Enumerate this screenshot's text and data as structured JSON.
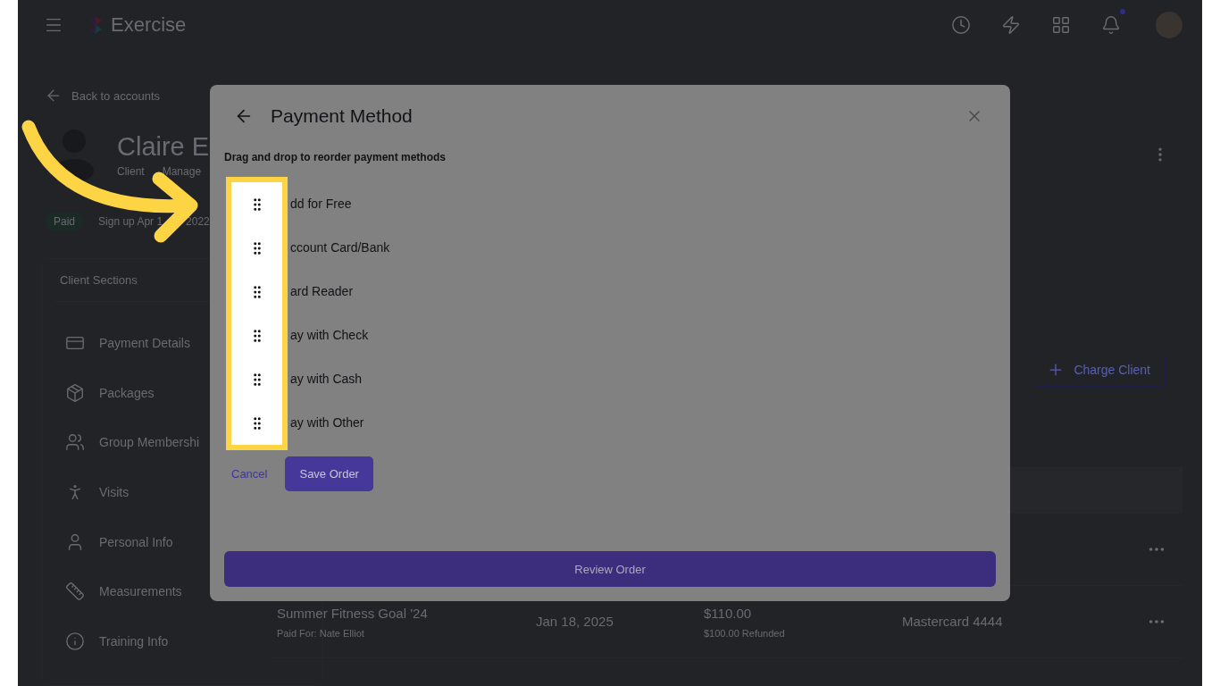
{
  "topbar": {
    "brand": "Exercise"
  },
  "client": {
    "back_link": "Back to accounts",
    "name": "Claire E",
    "subtitle_parts": [
      "Client",
      "Manage"
    ],
    "status": "Paid",
    "signup_parts": [
      "Sign up Apr 1",
      "2022"
    ]
  },
  "sidebar": {
    "heading": "Client Sections",
    "items": [
      {
        "label": "Payment Details"
      },
      {
        "label": "Packages"
      },
      {
        "label": "Group Membershi"
      },
      {
        "label": "Visits"
      },
      {
        "label": "Personal Info"
      },
      {
        "label": "Measurements"
      },
      {
        "label": "Training Info"
      }
    ]
  },
  "charge_button": "Charge Client",
  "table": {
    "rows": [
      {},
      {
        "title": "Summer Fitness Goal '24",
        "paid_for": "Paid For: Nate Elliot",
        "date": "Jan 18, 2025",
        "amount": "$110.00",
        "refund": "$100.00 Refunded",
        "method": "Mastercard 4444"
      }
    ]
  },
  "modal": {
    "title": "Payment Method",
    "instruction": "Drag and drop to reorder payment methods",
    "methods": [
      {
        "label": "dd for Free"
      },
      {
        "label": "ccount Card/Bank"
      },
      {
        "label": "ard Reader"
      },
      {
        "label": "ay with Check"
      },
      {
        "label": "ay with Cash"
      },
      {
        "label": "ay with Other"
      }
    ],
    "cancel": "Cancel",
    "save": "Save Order",
    "review": "Review Order"
  }
}
